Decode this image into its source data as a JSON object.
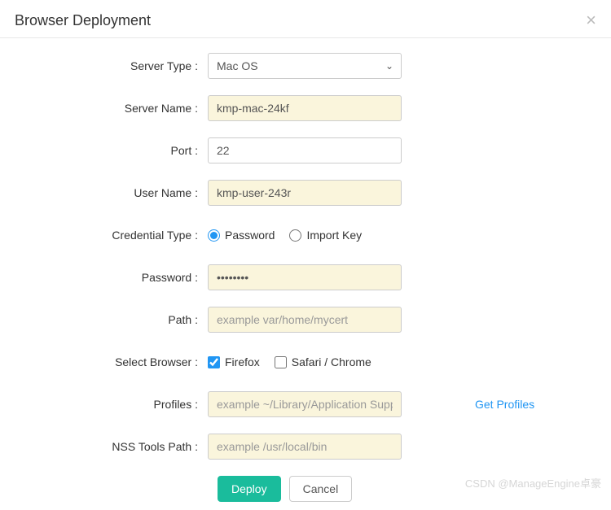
{
  "header": {
    "title": "Browser Deployment"
  },
  "form": {
    "serverType": {
      "label": "Server Type :",
      "value": "Mac OS"
    },
    "serverName": {
      "label": "Server Name :",
      "value": "kmp-mac-24kf"
    },
    "port": {
      "label": "Port :",
      "value": "22"
    },
    "userName": {
      "label": "User Name :",
      "value": "kmp-user-243r"
    },
    "credentialType": {
      "label": "Credential Type :",
      "options": {
        "password": "Password",
        "importKey": "Import Key"
      },
      "selected": "password"
    },
    "password": {
      "label": "Password :",
      "value": "••••••••"
    },
    "path": {
      "label": "Path :",
      "placeholder": "example var/home/mycert"
    },
    "selectBrowser": {
      "label": "Select Browser :",
      "options": {
        "firefox": "Firefox",
        "safariChrome": "Safari / Chrome"
      },
      "checked": [
        "firefox"
      ]
    },
    "profiles": {
      "label": "Profiles :",
      "placeholder": "example ~/Library/Application Support/",
      "linkText": "Get Profiles"
    },
    "nssToolsPath": {
      "label": "NSS Tools Path :",
      "placeholder": "example /usr/local/bin"
    }
  },
  "buttons": {
    "deploy": "Deploy",
    "cancel": "Cancel"
  },
  "watermark": "CSDN @ManageEngine卓豪"
}
